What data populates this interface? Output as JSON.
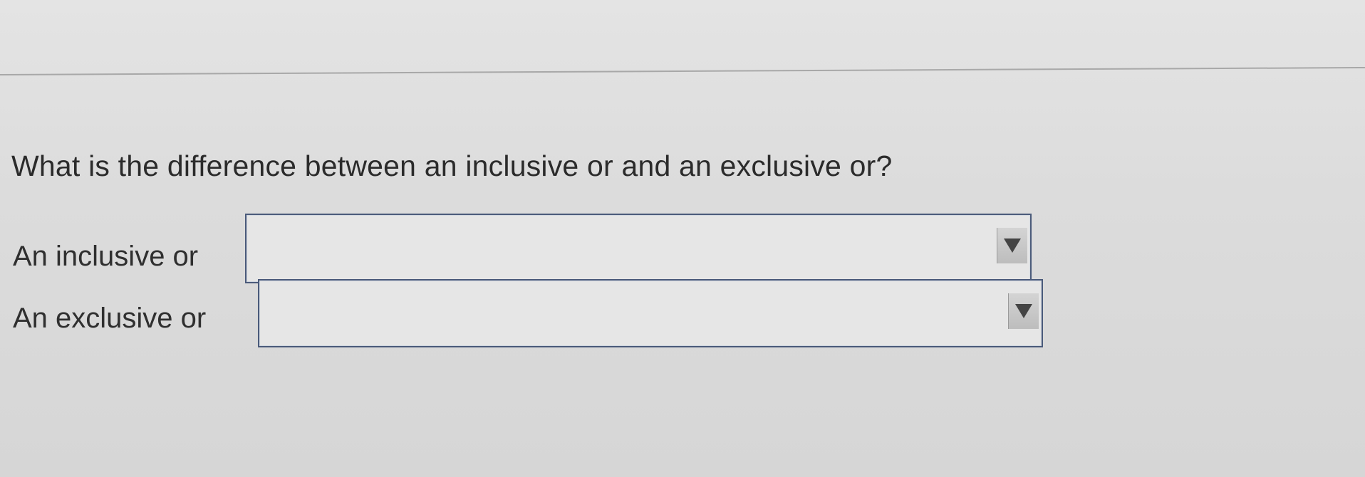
{
  "question": {
    "text": "What is the difference between an inclusive or and an exclusive or?"
  },
  "rows": [
    {
      "label": "An inclusive or",
      "selected_value": ""
    },
    {
      "label": "An exclusive or",
      "selected_value": ""
    }
  ],
  "icons": {
    "dropdown": "triangle-down-icon"
  },
  "colors": {
    "text": "#2b2b2b",
    "select_border": "#4a5a7a",
    "background": "#dcdcdc"
  }
}
